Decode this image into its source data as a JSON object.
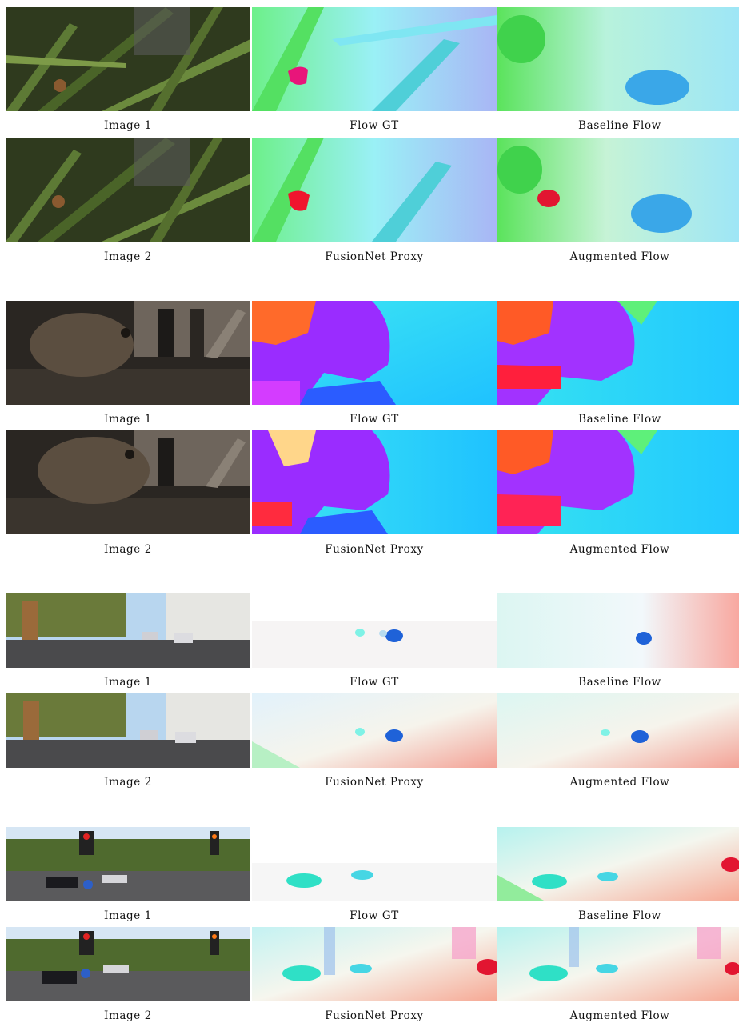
{
  "figure": {
    "groups": [
      {
        "scene": "sintel-grass",
        "rows": [
          {
            "captions": [
              "Image 1",
              "Flow GT",
              "Baseline Flow"
            ]
          },
          {
            "captions": [
              "Image 2",
              "FusionNet Proxy",
              "Augmented Flow"
            ]
          }
        ]
      },
      {
        "scene": "sintel-dragon",
        "rows": [
          {
            "captions": [
              "Image 1",
              "Flow GT",
              "Baseline Flow"
            ]
          },
          {
            "captions": [
              "Image 2",
              "FusionNet Proxy",
              "Augmented Flow"
            ]
          }
        ]
      },
      {
        "scene": "kitti-street",
        "rows": [
          {
            "captions": [
              "Image 1",
              "Flow GT",
              "Baseline Flow"
            ]
          },
          {
            "captions": [
              "Image 2",
              "FusionNet Proxy",
              "Augmented Flow"
            ]
          }
        ]
      },
      {
        "scene": "kitti-intersection",
        "rows": [
          {
            "captions": [
              "Image 1",
              "Flow GT",
              "Baseline Flow"
            ]
          },
          {
            "captions": [
              "Image 2",
              "FusionNet Proxy",
              "Augmented Flow"
            ]
          }
        ]
      }
    ]
  },
  "colors": {
    "grass_dark": "#2f3a1e",
    "flow_green": "#6df08a",
    "flow_cyan": "#7fe6f2",
    "flow_purple": "#9a2cff",
    "flow_red": "#ff2a2a",
    "kitti_sky": "#dcecf6"
  }
}
